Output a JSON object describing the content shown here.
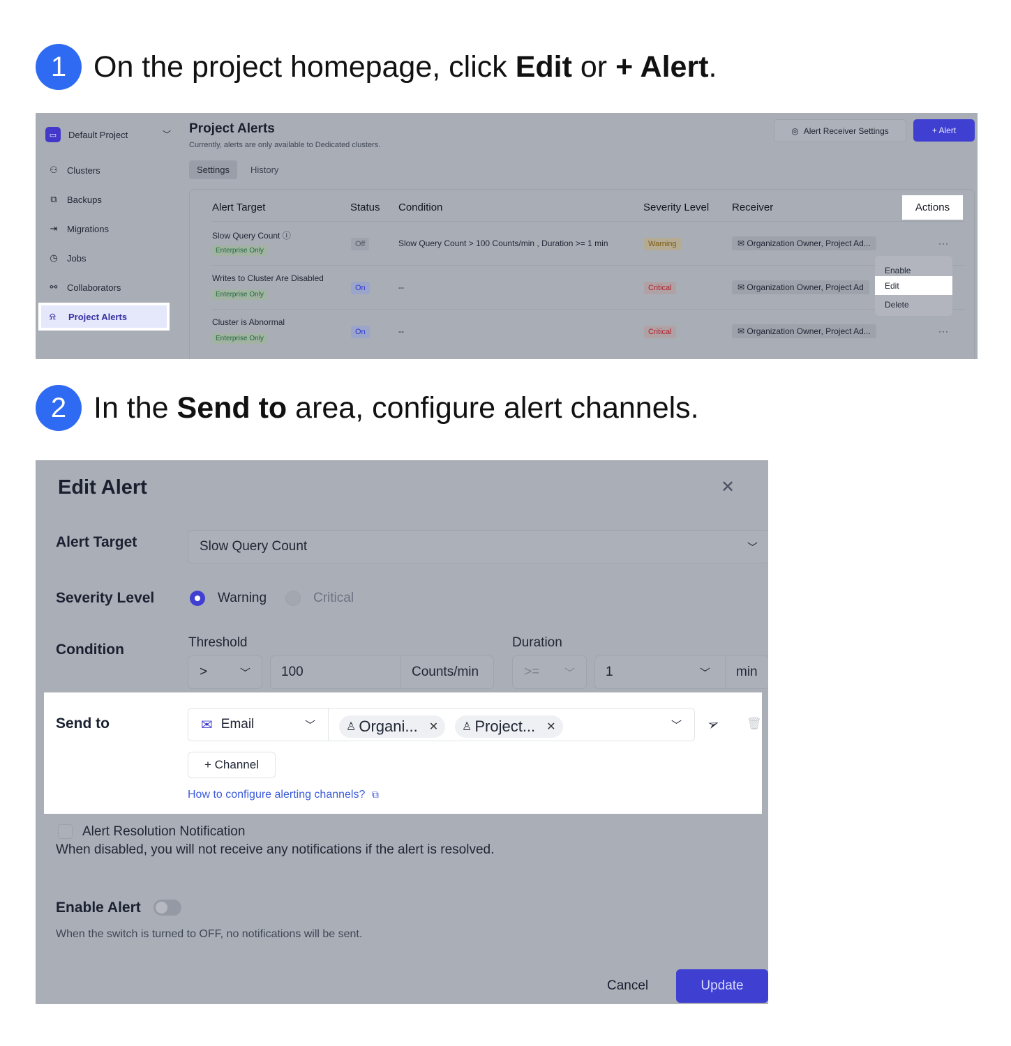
{
  "step1": {
    "number": "1",
    "text_before": "On the project homepage, click ",
    "bold1": "Edit",
    "text_mid": " or ",
    "bold2": "+ Alert",
    "text_after": "."
  },
  "step2": {
    "number": "2",
    "text_before": "In the ",
    "bold1": "Send to",
    "text_after": " area, configure alert channels."
  },
  "screen1": {
    "project_selector": {
      "badge_icon": "folder-icon",
      "label": "Default Project"
    },
    "sidebar": [
      {
        "icon": "clusters-icon",
        "glyph": "⚇",
        "label": "Clusters"
      },
      {
        "icon": "backups-icon",
        "glyph": "⧉",
        "label": "Backups"
      },
      {
        "icon": "migrations-icon",
        "glyph": "⇥",
        "label": "Migrations"
      },
      {
        "icon": "jobs-icon",
        "glyph": "◷",
        "label": "Jobs"
      },
      {
        "icon": "collaborators-icon",
        "glyph": "⚯",
        "label": "Collaborators"
      }
    ],
    "active_item": {
      "icon": "alarm-icon",
      "glyph": "⍾",
      "label": "Project Alerts"
    },
    "title": "Project Alerts",
    "subtitle": "Currently, alerts are only available to Dedicated clusters.",
    "tabs": [
      "Settings",
      "History"
    ],
    "receiver_button": "Alert Receiver Settings",
    "alert_button": "+ Alert",
    "columns": [
      "Alert Target",
      "Status",
      "Condition",
      "Severity Level",
      "Receiver",
      "Actions"
    ],
    "rows": [
      {
        "target": "Slow Query Count ⓘ",
        "tag": "Enterprise Only",
        "status": "Off",
        "condition": "Slow Query Count > 100 Counts/min , Duration >= 1 min",
        "severity": "Warning",
        "receiver": "✉ Organization Owner, Project Ad..."
      },
      {
        "target": "Writes to Cluster Are Disabled",
        "tag": "Enterprise Only",
        "status": "On",
        "condition": "--",
        "severity": "Critical",
        "receiver": "✉ Organization Owner, Project Ad"
      },
      {
        "target": "Cluster is Abnormal",
        "tag": "Enterprise Only",
        "status": "On",
        "condition": "--",
        "severity": "Critical",
        "receiver": "✉ Organization Owner, Project Ad..."
      }
    ],
    "more_glyph": "···",
    "menu": [
      "Enable",
      "Edit",
      "Delete"
    ]
  },
  "screen2": {
    "title": "Edit Alert",
    "alert_target_label": "Alert Target",
    "alert_target_value": "Slow Query Count",
    "severity_label": "Severity Level",
    "severity_options": [
      "Warning",
      "Critical"
    ],
    "severity_selected": "Warning",
    "condition_label": "Condition",
    "threshold_label": "Threshold",
    "threshold_op": ">",
    "threshold_value": "100",
    "threshold_unit": "Counts/min",
    "duration_label": "Duration",
    "duration_op": ">=",
    "duration_value": "1",
    "duration_unit": "min",
    "send_to_label": "Send to",
    "channel_type": "Email",
    "recipients": [
      "Organi...",
      "Project..."
    ],
    "add_channel": "+ Channel",
    "help_link": "How to configure alerting channels?",
    "resolution_label": "Alert Resolution Notification",
    "resolution_desc": "When disabled, you will not receive any notifications if the alert is resolved.",
    "enable_label": "Enable Alert",
    "enable_state": "off",
    "enable_note": "When the switch is turned to OFF, no notifications will be sent.",
    "cancel": "Cancel",
    "update": "Update"
  }
}
